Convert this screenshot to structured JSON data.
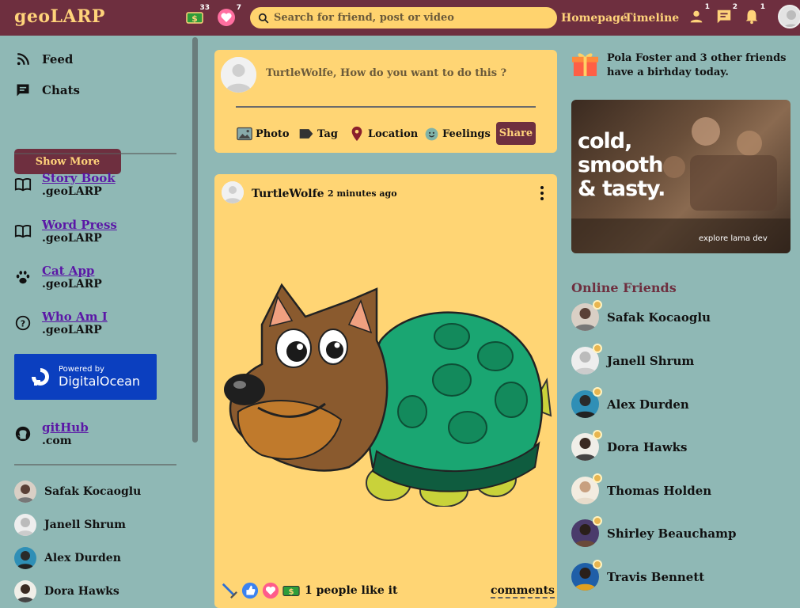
{
  "app": {
    "logo": "geoLARP"
  },
  "topbar": {
    "coins_count": "33",
    "hearts_count": "7",
    "search_placeholder": "Search for friend, post or video",
    "homepage_link": "Homepage",
    "timeline_link": "Timeline",
    "friends_badge": "1",
    "messages_badge": "2",
    "notifications_badge": "1"
  },
  "sidebar": {
    "items": [
      {
        "label": "Feed",
        "icon": "rss-icon"
      },
      {
        "label": "Chats",
        "icon": "chat-icon"
      }
    ],
    "show_more": "Show More",
    "links": [
      {
        "title": "Story Book",
        "sub": ".geoLARP",
        "icon": "book-icon"
      },
      {
        "title": "Word Press",
        "sub": ".geoLARP",
        "icon": "book-icon"
      },
      {
        "title": "Cat App",
        "sub": ".geoLARP",
        "icon": "paw-icon"
      },
      {
        "title": "Who Am I",
        "sub": ".geoLARP",
        "icon": "question-icon"
      }
    ],
    "sponsor": {
      "powered_by": "Powered by",
      "name": "DigitalOcean"
    },
    "github": {
      "title": "gitHub",
      "sub": ".com"
    },
    "friends": [
      "Safak Kocaoglu",
      "Janell Shrum",
      "Alex Durden",
      "Dora Hawks"
    ]
  },
  "share": {
    "placeholder": "TurtleWolfe, How do you want to do this ?",
    "options": [
      "Photo",
      "Tag",
      "Location",
      "Feelings"
    ],
    "share_button": "Share"
  },
  "post": {
    "username": "TurtleWolfe",
    "time": "2 minutes ago",
    "likes_text": "1 people like it",
    "comments_label": "comments"
  },
  "right": {
    "birthday_text": "Pola Foster and 3 other friends have a birhday today.",
    "ad_title_lines": [
      "cold,",
      "smooth",
      "& tasty."
    ],
    "ad_footer": "explore lama dev",
    "online_title": "Online Friends",
    "online_friends": [
      "Safak Kocaoglu",
      "Janell Shrum",
      "Alex Durden",
      "Dora Hawks",
      "Thomas Holden",
      "Shirley Beauchamp",
      "Travis Bennett"
    ]
  },
  "colors": {
    "topbar": "#6e2f3f",
    "accent_yellow": "#ffd574",
    "background": "#8fb8b5",
    "link_purple": "#5b17a6",
    "digitalocean_blue": "#0b3fbf"
  }
}
